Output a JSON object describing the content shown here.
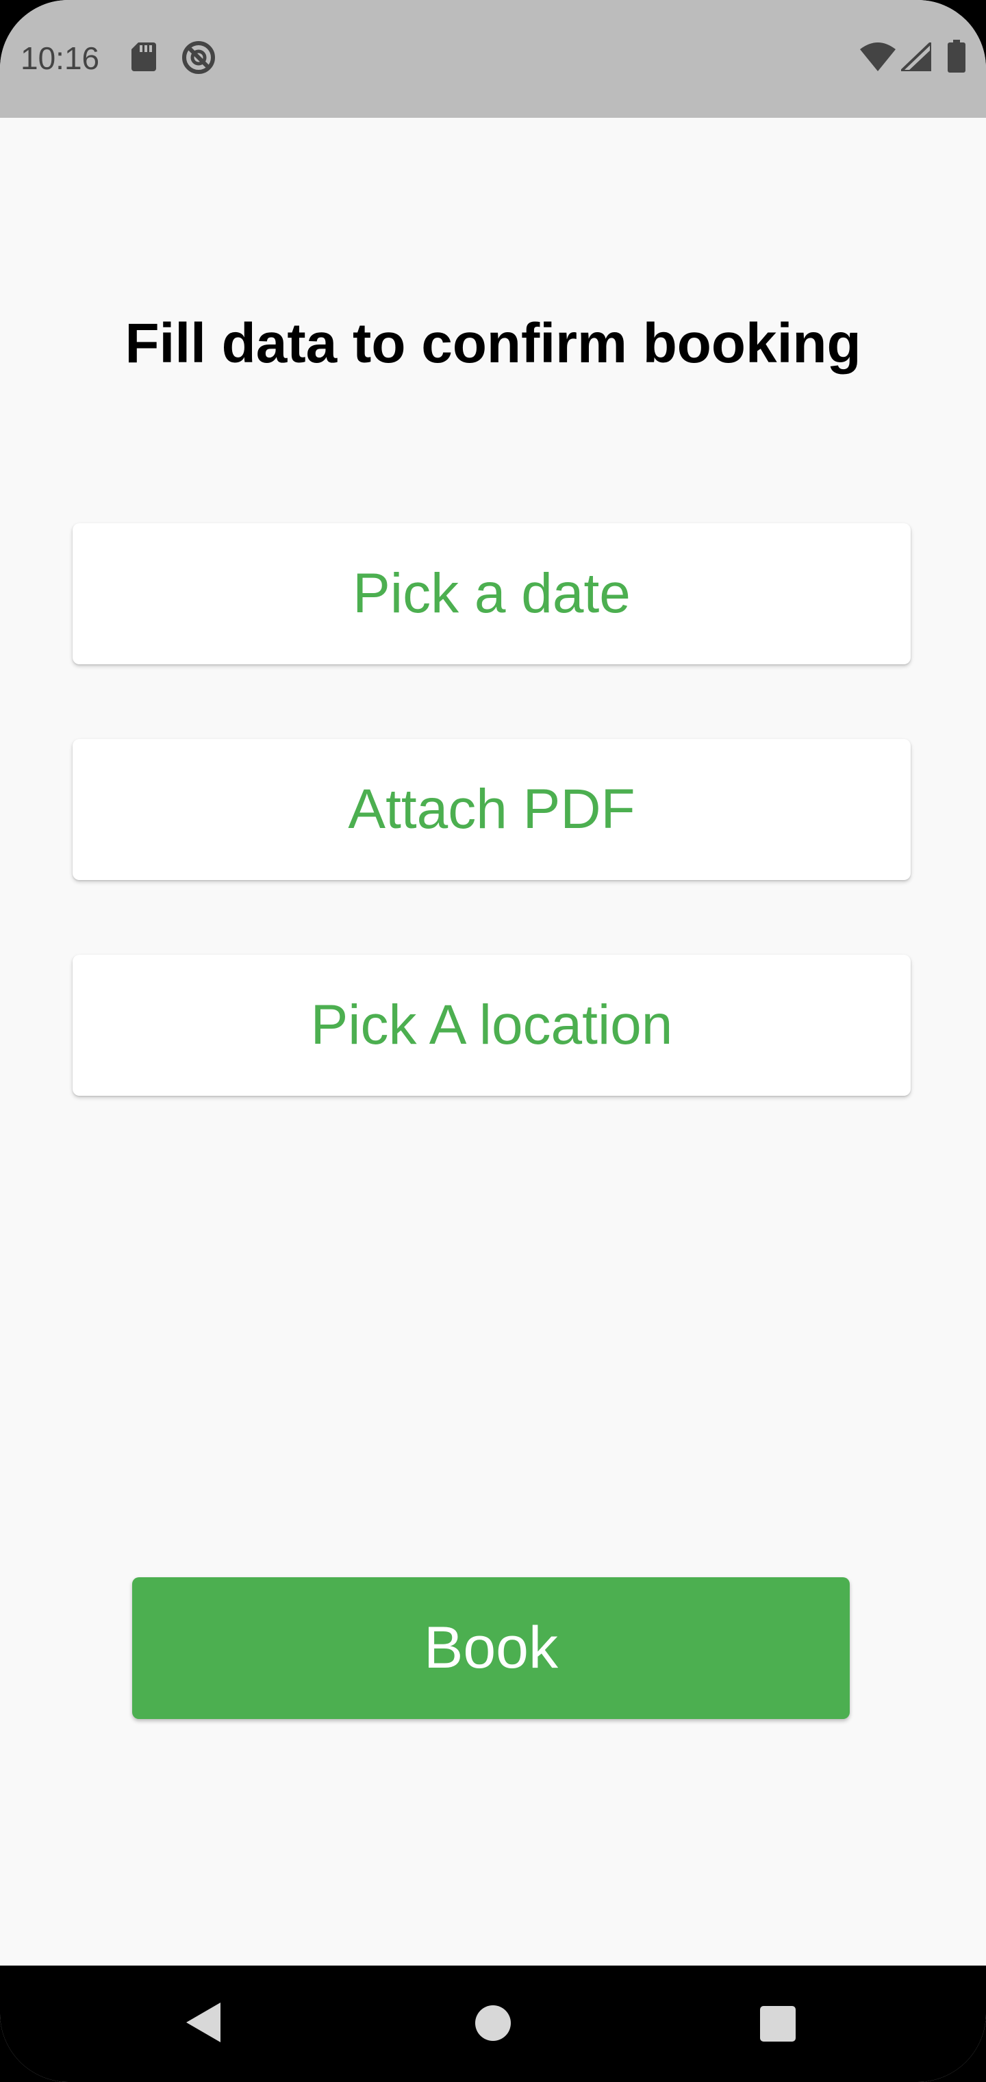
{
  "status_bar": {
    "time": "10:16",
    "icons": [
      "sd-card-icon",
      "do-not-disturb-icon",
      "wifi-icon",
      "cellular-signal-icon",
      "battery-icon"
    ]
  },
  "page": {
    "title": "Fill data to confirm booking"
  },
  "options": {
    "pick_date_label": "Pick a date",
    "attach_pdf_label": "Attach PDF",
    "pick_location_label": "Pick A location"
  },
  "actions": {
    "book_label": "Book"
  },
  "nav_bar": {
    "icons": [
      "back-icon",
      "home-icon",
      "recents-icon"
    ]
  },
  "colors": {
    "accent": "#4caf50",
    "status_bar": "#bcbcbc",
    "background": "#f9f9f9"
  }
}
